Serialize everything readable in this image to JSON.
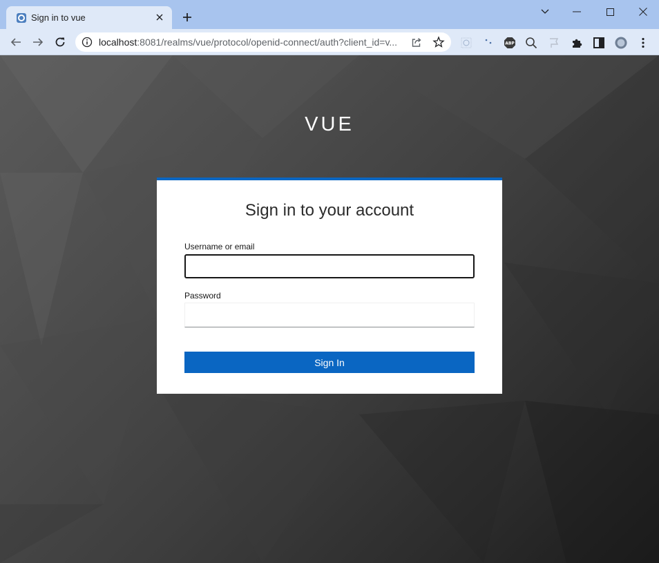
{
  "browser": {
    "tab_title": "Sign in to vue",
    "url_host": "localhost",
    "url_rest": ":8081/realms/vue/protocol/openid-connect/auth?client_id=v...",
    "extensions": [
      "abp-icon",
      "zoom-icon",
      "puzzle-icon",
      "sidepanel-icon",
      "profile-icon"
    ]
  },
  "page": {
    "brand": "VUE",
    "card_title": "Sign in to your account",
    "username_label": "Username or email",
    "username_value": "",
    "password_label": "Password",
    "password_value": "",
    "signin_label": "Sign In"
  },
  "colors": {
    "accent": "#0a66c2",
    "tabstrip": "#a8c4ee",
    "toolbar": "#dfe9f8"
  }
}
